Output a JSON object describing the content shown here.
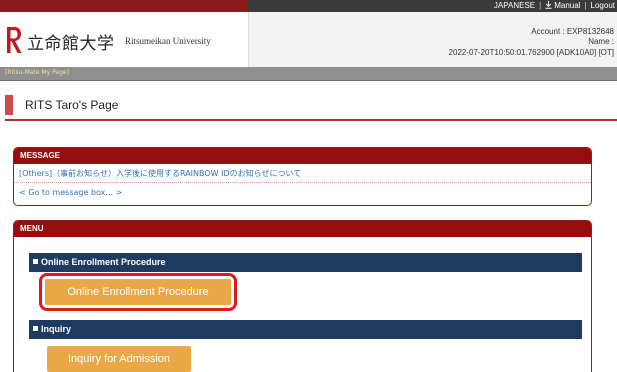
{
  "topbar": {
    "language": "JAPANESE",
    "manual": "Manual",
    "logout": "Logout",
    "separator": "|"
  },
  "header": {
    "logo_jp": "立命館大学",
    "logo_en": "Ritsumeikan University",
    "account_label": "Account : EXP8132648",
    "name_label": "Name :",
    "session_info": "2022-07-20T10:50:01.762900 [ADK10A0] [OT]"
  },
  "breadcrumb": "[Ritsu-Mate My Page]",
  "page_title": "RITS Taro's Page",
  "message_panel": {
    "heading": "MESSAGE",
    "items": [
      "[Others]（事前お知らせ）入学後に使用するRAINBOW IDのお知らせについて"
    ],
    "go_to_box": "< Go to message box... >"
  },
  "menu_panel": {
    "heading": "MENU",
    "sections": [
      {
        "title": "Online Enrollment Procedure",
        "button": "Online Enrollment Procedure"
      },
      {
        "title": "Inquiry",
        "button": "Inquiry for Admission"
      }
    ]
  },
  "colors": {
    "brand_red": "#960d0d",
    "section_navy": "#1e3a5f",
    "button_orange": "#eaa746",
    "highlight_red": "#e0191e",
    "link_blue": "#3a6fb0"
  }
}
